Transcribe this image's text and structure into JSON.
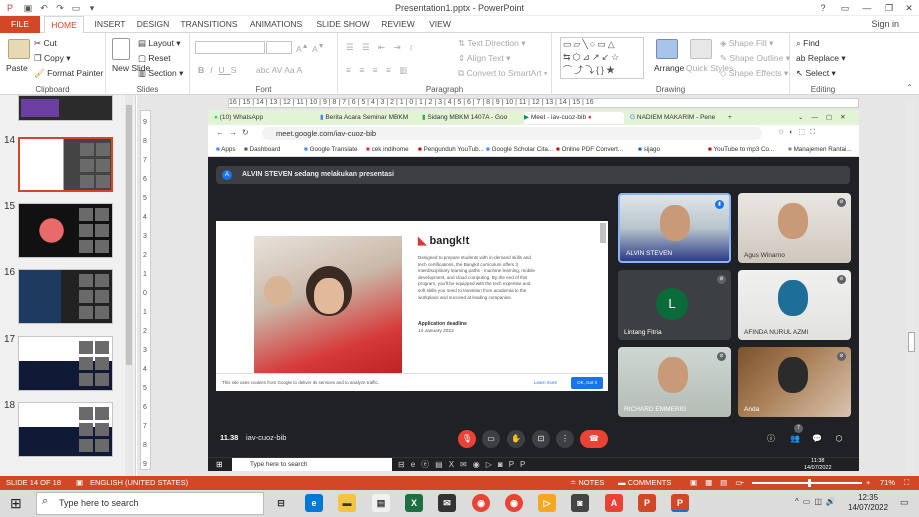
{
  "window": {
    "title": "Presentation1.pptx - PowerPoint",
    "help": "?",
    "minimize": "—",
    "restore": "❐",
    "close": "✕",
    "sign_in": "Sign in"
  },
  "ribbon_tabs": [
    "FILE",
    "HOME",
    "INSERT",
    "DESIGN",
    "TRANSITIONS",
    "ANIMATIONS",
    "SLIDE SHOW",
    "REVIEW",
    "VIEW"
  ],
  "clipboard": {
    "paste": "Paste",
    "cut": "Cut",
    "copy": "Copy",
    "format_painter": "Format Painter",
    "label": "Clipboard"
  },
  "slides_grp": {
    "new_slide": "New Slide",
    "layout": "Layout",
    "reset": "Reset",
    "section": "Section",
    "label": "Slides"
  },
  "font_grp": {
    "label": "Font"
  },
  "paragraph_grp": {
    "text_direction": "Text Direction",
    "align_text": "Align Text",
    "smartart": "Convert to SmartArt",
    "label": "Paragraph"
  },
  "drawing_grp": {
    "arrange": "Arrange",
    "quick_styles": "Quick Styles",
    "shape_fill": "Shape Fill",
    "shape_outline": "Shape Outline",
    "shape_effects": "Shape Effects",
    "label": "Drawing"
  },
  "editing_grp": {
    "find": "Find",
    "replace": "Replace",
    "select": "Select",
    "label": "Editing"
  },
  "ruler_h": "16 | 15 | 14 | 13 | 12 | 11 | 10 | 9 | 8 | 7 | 6 | 5 | 4 | 3 | 2 | 1 | 0 | 1 | 2 | 3 | 4 | 5 | 6 | 7 | 8 | 9 | 10 | 11 | 12 | 13 | 14 | 15 | 16",
  "ruler_v": [
    "9",
    "8",
    "7",
    "6",
    "5",
    "4",
    "3",
    "2",
    "1",
    "0",
    "1",
    "2",
    "3",
    "4",
    "5",
    "6",
    "7",
    "8",
    "9"
  ],
  "thumbnails": [
    {
      "num": "14",
      "selected": true
    },
    {
      "num": "15",
      "selected": false
    },
    {
      "num": "16",
      "selected": false
    },
    {
      "num": "17",
      "selected": false
    },
    {
      "num": "18",
      "selected": false
    }
  ],
  "browser": {
    "tabs": [
      "(10) WhatsApp",
      "Berita Acara Seminar MBKM",
      "Sidang MBKM 1407A - Goo",
      "Meet - iav-cuoz-bib",
      "NADIEM MAKARIM - Pene"
    ],
    "url": "meet.google.com/iav-cuoz-bib",
    "bookmarks": [
      "Apps",
      "Dashboard",
      "Google Translate",
      "cek indihome",
      "Pengunduh YouTub...",
      "Google Scholar Cita...",
      "Online PDF Convert...",
      "sijago",
      "YouTube to mp3 Co...",
      "Manajemen Rantai..."
    ]
  },
  "meet": {
    "presenter_initial": "A",
    "presenter_banner": "ALVIN STEVEN sedang melakukan presentasi",
    "shared": {
      "brand": "bangk!t",
      "body": "Designed to prepare students with in-demand skills and tech certifications, the Bangkit curriculum offers 3 interdisciplinary learning paths - machine learning, mobile development, and cloud computing. By the end of this program, you'll be equipped with the tech expertise and soft skills you need to transition from academia to the workplace and succeed at leading companies.",
      "deadline_label": "Application deadline",
      "deadline": "14 January 2022",
      "cookie": "This site uses cookies from Google to deliver its services and to analyze traffic.",
      "learn_more": "Learn more",
      "ok": "OK, Got it"
    },
    "participants": [
      {
        "name": "ALVIN STEVEN",
        "initial": ""
      },
      {
        "name": "Agus Winarno",
        "initial": ""
      },
      {
        "name": "Lintang Fitria",
        "initial": "L"
      },
      {
        "name": "AFINDA NURUL AZMI",
        "initial": ""
      },
      {
        "name": "RICHARD EMMERIG",
        "initial": ""
      },
      {
        "name": "Anda",
        "initial": ""
      }
    ],
    "time": "11.38",
    "meeting_code": "iav-cuoz-bib",
    "people_count": "7"
  },
  "inner_taskbar": {
    "search": "Type here to search",
    "time": "11:38",
    "date": "14/07/2022"
  },
  "status": {
    "slide": "SLIDE 14 OF 18",
    "language": "ENGLISH (UNITED STATES)",
    "notes": "NOTES",
    "comments": "COMMENTS",
    "zoom": "71%"
  },
  "taskbar": {
    "search": "Type here to search",
    "time": "12:35",
    "date": "14/07/2022"
  },
  "colors": {
    "accent": "#d24726",
    "meet_bg": "#202124",
    "hangup": "#ea4335"
  }
}
